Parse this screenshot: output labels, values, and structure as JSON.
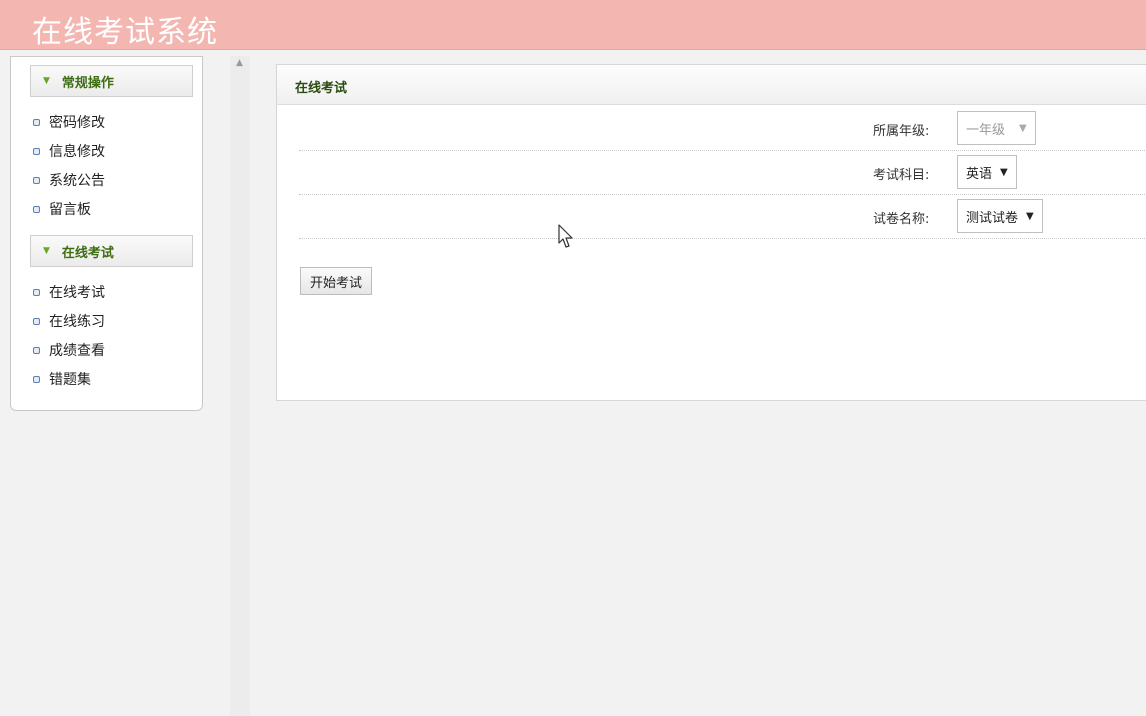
{
  "header": {
    "title": "在线考试系统"
  },
  "sidebar": {
    "groups": [
      {
        "label": "常规操作",
        "items": [
          "密码修改",
          "信息修改",
          "系统公告",
          "留言板"
        ]
      },
      {
        "label": "在线考试",
        "items": [
          "在线考试",
          "在线练习",
          "成绩查看",
          "错题集"
        ]
      }
    ]
  },
  "main": {
    "panel_title": "在线考试",
    "form": {
      "grade": {
        "label": "所属年级:",
        "value": "一年级"
      },
      "subject": {
        "label": "考试科目:",
        "value": "英语"
      },
      "paper": {
        "label": "试卷名称:",
        "value": "测试试卷"
      }
    },
    "start_button": "开始考试"
  },
  "colors": {
    "header_bg": "#f3b6b0",
    "menu_green": "#3e6d12"
  }
}
